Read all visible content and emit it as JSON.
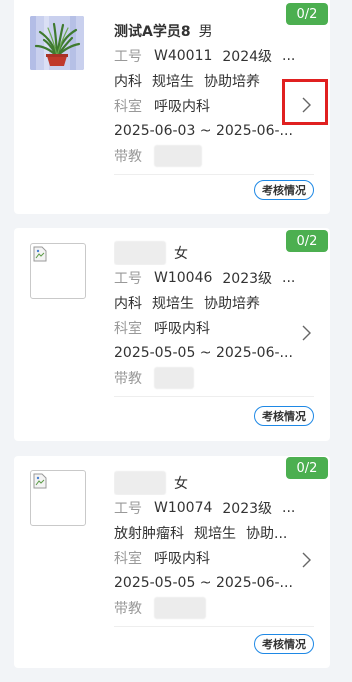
{
  "students": [
    {
      "badge": "0/2",
      "name": "测试A学员8",
      "gender": "男",
      "id_label": "工号",
      "id_value": "W40011",
      "grade": "2024级",
      "grade_more": "...",
      "department": "内科",
      "type": "规培生",
      "mode": "协助培养",
      "dept_label": "科室",
      "dept_value": "呼吸内科",
      "date_range": "2025-06-03 ~ 2025-06-...",
      "mentor_label": "带教",
      "assess_label": "考核情况",
      "avatar": "plant-photo"
    },
    {
      "badge": "0/2",
      "name": "",
      "gender": "女",
      "id_label": "工号",
      "id_value": "W10046",
      "grade": "2023级",
      "grade_more": "...",
      "department": "内科",
      "type": "规培生",
      "mode": "协助培养",
      "dept_label": "科室",
      "dept_value": "呼吸内科",
      "date_range": "2025-05-05 ~ 2025-06-...",
      "mentor_label": "带教",
      "assess_label": "考核情况",
      "avatar": "broken-image-icon"
    },
    {
      "badge": "0/2",
      "name": "",
      "gender": "女",
      "id_label": "工号",
      "id_value": "W10074",
      "grade": "2023级",
      "grade_more": "...",
      "department": "放射肿瘤科",
      "type": "规培生",
      "mode": "协助...",
      "dept_label": "科室",
      "dept_value": "呼吸内科",
      "date_range": "2025-05-05 ~ 2025-06-...",
      "mentor_label": "带教",
      "assess_label": "考核情况",
      "avatar": "broken-image-icon"
    }
  ],
  "colors": {
    "badge": "#4caf50",
    "assess_border": "#1e88e5",
    "highlight": "#e02020",
    "background": "#f2f4f7"
  },
  "icons": {
    "chevron": "chevron-right-icon",
    "broken_image": "broken-image-icon"
  }
}
